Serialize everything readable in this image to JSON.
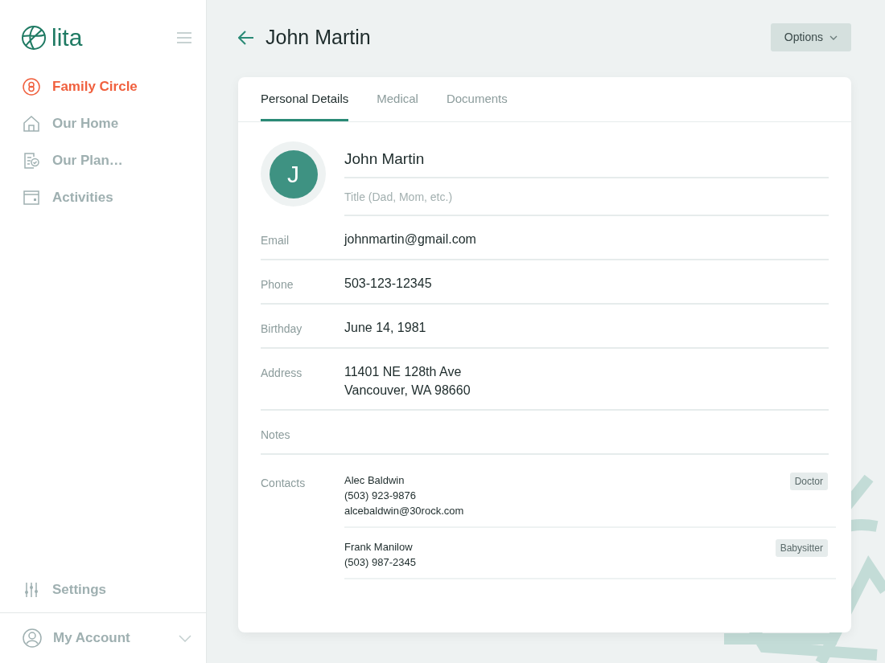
{
  "brand": {
    "name": "lita"
  },
  "nav": [
    {
      "label": "Family Circle",
      "kind": "circle",
      "selected": true
    },
    {
      "label": "Our Home",
      "kind": "home",
      "selected": false
    },
    {
      "label": "Our Plan…",
      "kind": "plan",
      "selected": false
    },
    {
      "label": "Activities",
      "kind": "wallet",
      "selected": false
    }
  ],
  "settings": {
    "label": "Settings"
  },
  "account": {
    "label": "My Account"
  },
  "header": {
    "title": "John Martin",
    "options": "Options"
  },
  "tabs": [
    {
      "label": "Personal Details",
      "selected": true
    },
    {
      "label": "Medical",
      "selected": false
    },
    {
      "label": "Documents",
      "selected": false
    }
  ],
  "profile": {
    "initial": "J",
    "name": "John Martin",
    "title_placeholder": "Title (Dad, Mom, etc.)"
  },
  "fields": [
    {
      "label": "Email",
      "lines": [
        "johnmartin@gmail.com"
      ]
    },
    {
      "label": "Phone",
      "lines": [
        "503-123-12345"
      ]
    },
    {
      "label": "Birthday",
      "lines": [
        "June 14, 1981"
      ]
    },
    {
      "label": "Address",
      "lines": [
        "11401 NE 128th Ave",
        "Vancouver, WA 98660"
      ]
    },
    {
      "label": "Notes"
    }
  ],
  "contacts": {
    "label": "Contacts",
    "items": [
      {
        "lines": [
          "Alec Baldwin",
          "(503) 923-9876",
          "alcebaldwin@30rock.com"
        ],
        "tag": "Doctor"
      },
      {
        "lines": [
          "Frank Manilow",
          "(503) 987-2345"
        ],
        "tag": "Babysitter"
      }
    ]
  }
}
